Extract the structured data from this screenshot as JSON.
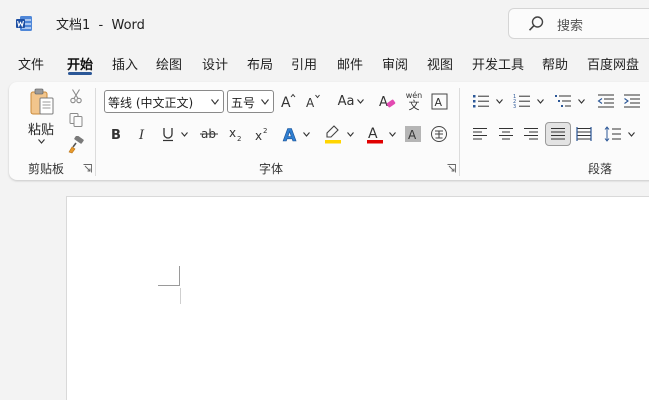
{
  "titlebar": {
    "title": "文档1  -  Word"
  },
  "search": {
    "placeholder": "搜索"
  },
  "menu": {
    "items": [
      {
        "label": "文件"
      },
      {
        "label": "开始"
      },
      {
        "label": "插入"
      },
      {
        "label": "绘图"
      },
      {
        "label": "设计"
      },
      {
        "label": "布局"
      },
      {
        "label": "引用"
      },
      {
        "label": "邮件"
      },
      {
        "label": "审阅"
      },
      {
        "label": "视图"
      },
      {
        "label": "开发工具"
      },
      {
        "label": "帮助"
      },
      {
        "label": "百度网盘"
      }
    ],
    "active": "开始"
  },
  "ribbon": {
    "clipboard": {
      "paste_label": "粘贴",
      "group_label": "剪贴板"
    },
    "font": {
      "font_name": "等线 (中文正文)",
      "font_size": "五号",
      "group_label": "字体",
      "change_case": "Aa",
      "pinyin_top": "wén",
      "pinyin_bottom": "文"
    },
    "paragraph": {
      "group_label": "段落"
    }
  },
  "colors": {
    "accent": "#2b5797",
    "highlight": "#ffd500",
    "font_color": "#e00000",
    "text_effect": "#2f7fd1",
    "word_blue": "#2b5797"
  }
}
